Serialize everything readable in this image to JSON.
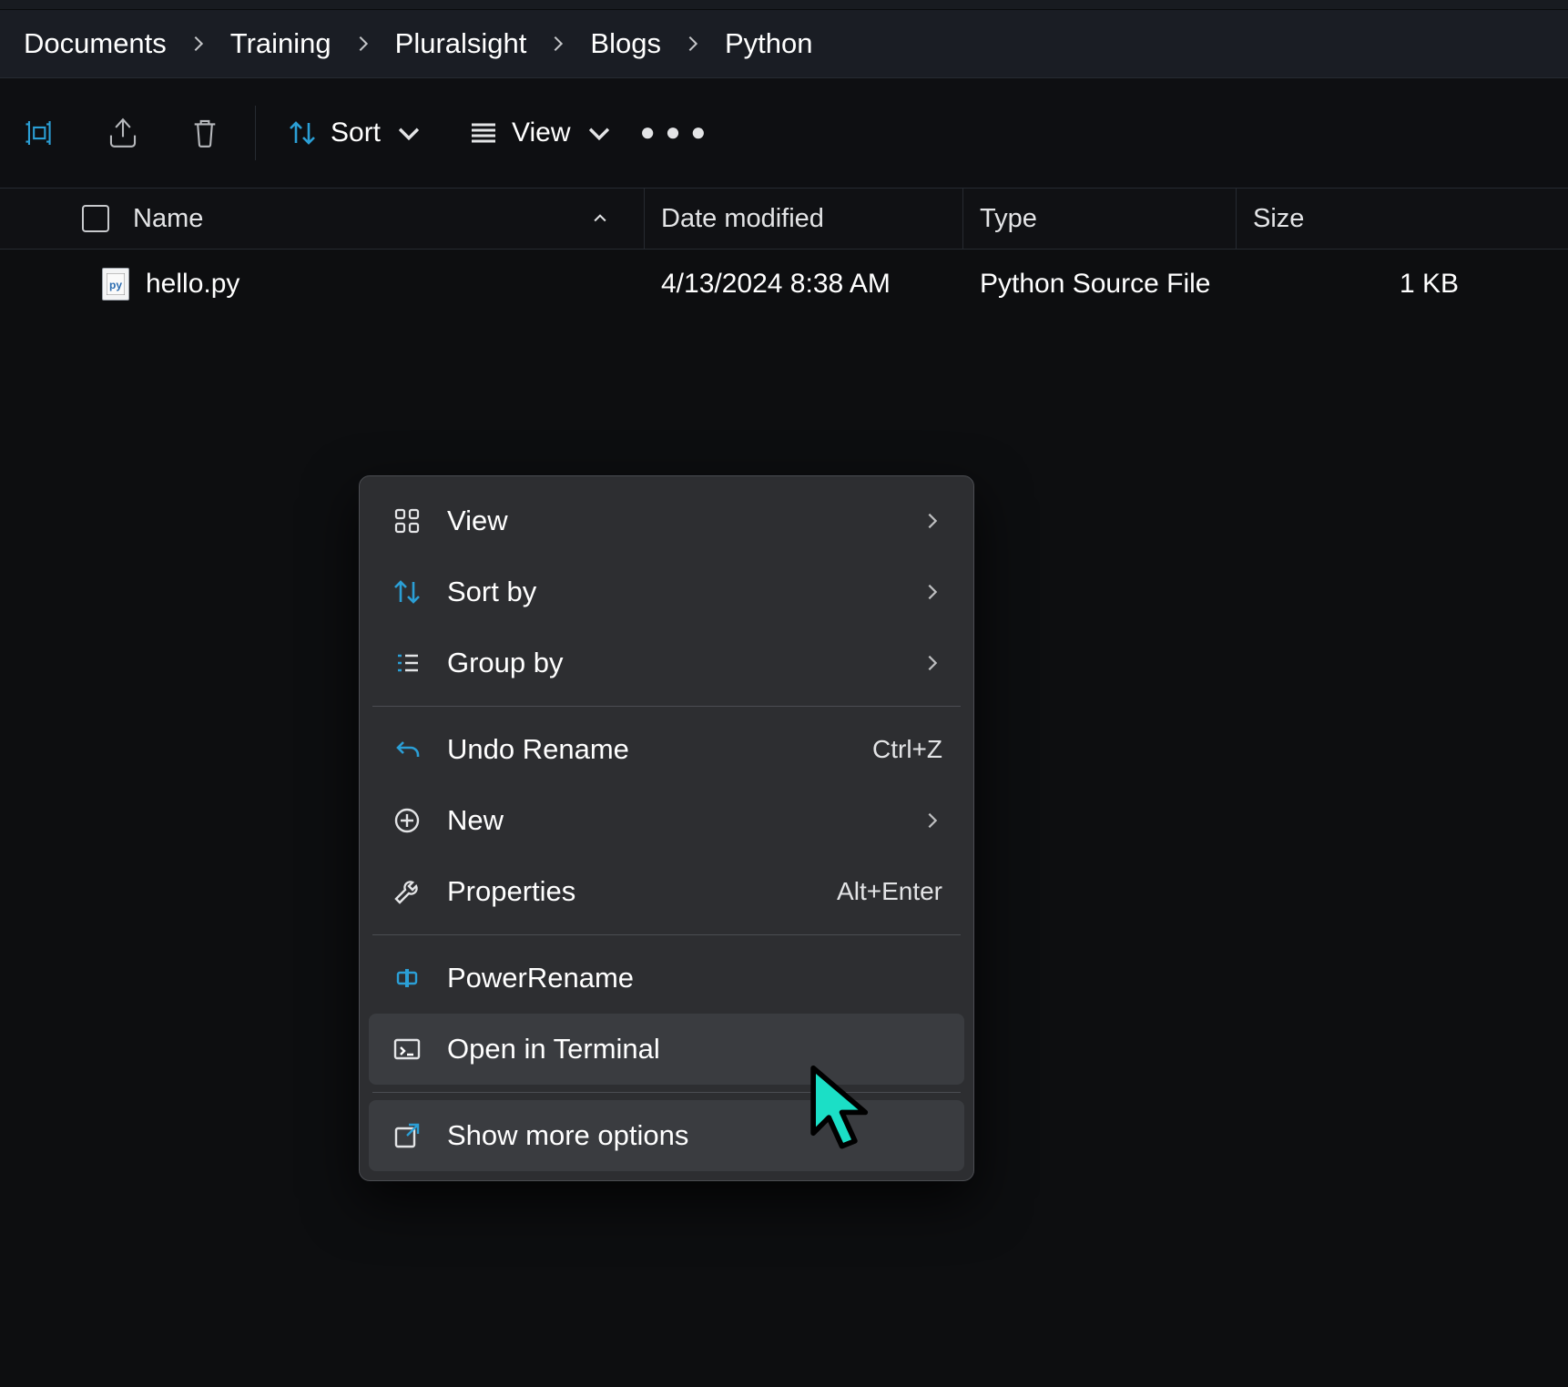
{
  "breadcrumb": [
    "Documents",
    "Training",
    "Pluralsight",
    "Blogs",
    "Python"
  ],
  "toolbar": {
    "sort_label": "Sort",
    "view_label": "View"
  },
  "columns": {
    "name": "Name",
    "date": "Date modified",
    "type": "Type",
    "size": "Size"
  },
  "files": [
    {
      "name": "hello.py",
      "date": "4/13/2024 8:38 AM",
      "type": "Python Source File",
      "size": "1 KB"
    }
  ],
  "context_menu": {
    "view": "View",
    "sort_by": "Sort by",
    "group_by": "Group by",
    "undo_rename": "Undo Rename",
    "undo_rename_accel": "Ctrl+Z",
    "new": "New",
    "properties": "Properties",
    "properties_accel": "Alt+Enter",
    "powerrename": "PowerRename",
    "open_in_terminal": "Open in Terminal",
    "show_more": "Show more options"
  }
}
